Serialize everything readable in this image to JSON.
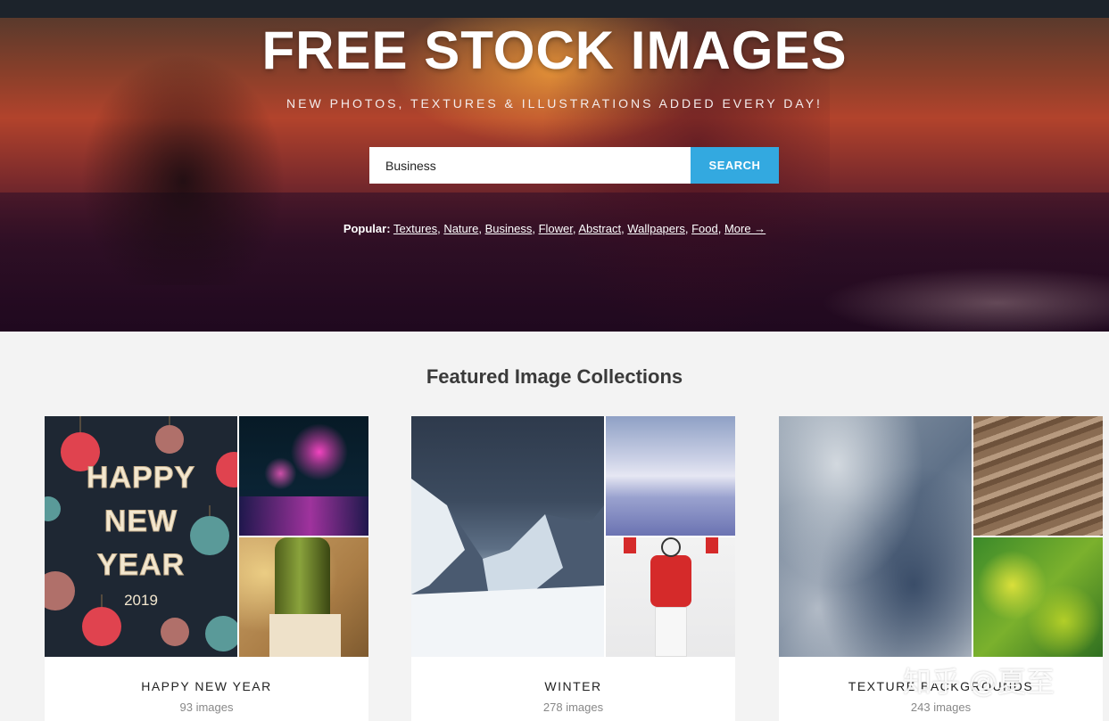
{
  "hero": {
    "title": "FREE STOCK IMAGES",
    "subtitle": "NEW PHOTOS, TEXTURES & ILLUSTRATIONS ADDED EVERY DAY!"
  },
  "search": {
    "value": "Business",
    "button_label": "SEARCH",
    "button_color": "#33a9e0"
  },
  "popular": {
    "label": "Popular:",
    "links": [
      "Textures",
      "Nature",
      "Business",
      "Flower",
      "Abstract",
      "Wallpapers",
      "Food"
    ],
    "more": "More →"
  },
  "section": {
    "title": "Featured Image Collections"
  },
  "collections": [
    {
      "title": "HAPPY NEW YEAR",
      "count": "93 images",
      "art": {
        "line1": "HAPPY",
        "line2": "NEW",
        "line3": "YEAR",
        "year": "2019"
      }
    },
    {
      "title": "WINTER",
      "count": "278 images"
    },
    {
      "title": "TEXTURE BACKGROUNDS",
      "count": "243 images"
    }
  ],
  "watermark": "知乎 @夏至"
}
